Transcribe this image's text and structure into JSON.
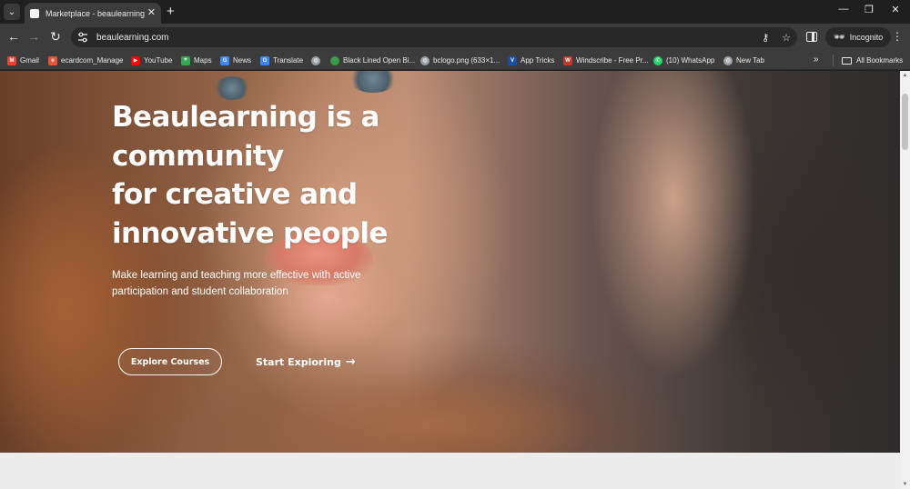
{
  "browser": {
    "tab": {
      "title": "Marketplace - beaulearning",
      "close": "✕"
    },
    "new_tab": "+",
    "window_controls": {
      "minimize": "—",
      "restore": "❐",
      "close": "✕"
    },
    "address": {
      "url": "beaulearning.com"
    },
    "incognito_label": "Incognito",
    "bookmarks": [
      {
        "label": "Gmail",
        "icon": "gmail-icon",
        "color": "#ea4335"
      },
      {
        "label": "ecardcom_Manage",
        "icon": "ecardcom-icon",
        "color": "#e8533b"
      },
      {
        "label": "YouTube",
        "icon": "youtube-icon",
        "color": "#ff0000"
      },
      {
        "label": "Maps",
        "icon": "maps-icon",
        "color": "#34a853"
      },
      {
        "label": "News",
        "icon": "news-icon",
        "color": "#4285f4"
      },
      {
        "label": "Translate",
        "icon": "translate-icon",
        "color": "#4285f4"
      },
      {
        "label": "",
        "icon": "globe-icon",
        "color": "#9aa0a6"
      },
      {
        "label": "Black Lined Open Bi...",
        "icon": "site-icon",
        "color": "#3c9a4a"
      },
      {
        "label": "bclogo.png (633×1...",
        "icon": "globe-icon",
        "color": "#9aa0a6"
      },
      {
        "label": "App Tricks",
        "icon": "apptricks-icon",
        "color": "#1a4fa0"
      },
      {
        "label": "Windscribe - Free Pr...",
        "icon": "windscribe-icon",
        "color": "#c0392b"
      },
      {
        "label": "(10) WhatsApp",
        "icon": "whatsapp-icon",
        "color": "#25d366"
      },
      {
        "label": "New Tab",
        "icon": "globe-icon",
        "color": "#9aa0a6"
      }
    ],
    "all_bookmarks_label": "All Bookmarks"
  },
  "hero": {
    "headline_lines": [
      "Beaulearning is a",
      "community",
      "for creative and",
      "innovative people"
    ],
    "subtext": "Make learning and teaching more effective with active participation and student collaboration",
    "primary_button": "Explore Courses",
    "secondary_button": "Start Exploring",
    "secondary_arrow": "→"
  }
}
